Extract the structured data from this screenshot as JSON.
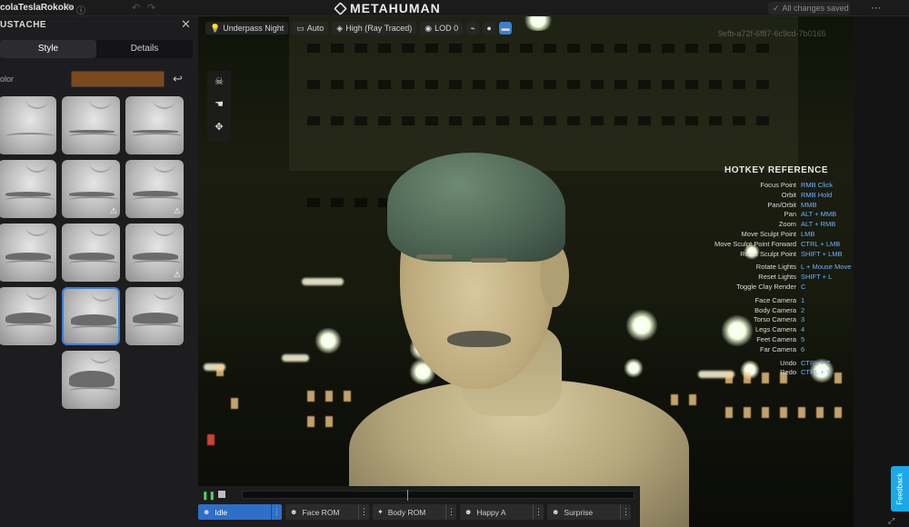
{
  "topbar": {
    "project_name": "colaTeslaRokoko",
    "logo_text": "METAHUMAN",
    "saved_status": "All changes saved"
  },
  "panel": {
    "title": "USTACHE",
    "tabs": [
      {
        "label": "Style",
        "active": true
      },
      {
        "label": "Details",
        "active": false
      }
    ],
    "color_label": "olor",
    "color_value": "#7a4a1c",
    "thumbnails": [
      {
        "style": "none",
        "warning": false
      },
      {
        "style": "faint",
        "warning": false
      },
      {
        "style": "faint",
        "warning": false
      },
      {
        "style": "thin",
        "warning": false
      },
      {
        "style": "thin",
        "warning": true
      },
      {
        "style": "pencil",
        "warning": true
      },
      {
        "style": "medium",
        "warning": false
      },
      {
        "style": "medium",
        "warning": false
      },
      {
        "style": "medium",
        "warning": true
      },
      {
        "style": "full",
        "warning": false
      },
      {
        "style": "full",
        "warning": false,
        "selected": true
      },
      {
        "style": "full",
        "warning": false
      },
      {
        "style": "walrus",
        "warning": false
      }
    ]
  },
  "viewport": {
    "toolbar": {
      "lighting": "Underpass Night",
      "camera": "Auto",
      "quality": "High (Ray Traced)",
      "lod": "LOD 0"
    },
    "asset_id": "9efb-a72f-6f87-6c9cd-7b0165",
    "hotkeys": {
      "title": "HOTKEY REFERENCE",
      "groups": [
        [
          {
            "action": "Focus Point",
            "key": "RMB Click"
          },
          {
            "action": "Orbit",
            "key": "RMB Hold"
          },
          {
            "action": "Pan/Orbit",
            "key": "MMB"
          },
          {
            "action": "Pan",
            "key": "ALT + MMB"
          },
          {
            "action": "Zoom",
            "key": "ALT + RMB"
          },
          {
            "action": "Move Sculpt Point",
            "key": "LMB"
          },
          {
            "action": "Move Sculpt Point Forward",
            "key": "CTRL + LMB"
          },
          {
            "action": "Reset Sculpt Point",
            "key": "SHIFT + LMB"
          }
        ],
        [
          {
            "action": "Rotate Lights",
            "key": "L + Mouse Move"
          },
          {
            "action": "Reset Lights",
            "key": "SHIFT + L"
          },
          {
            "action": "Toggle Clay Render",
            "key": "C"
          }
        ],
        [
          {
            "action": "Face Camera",
            "key": "1"
          },
          {
            "action": "Body Camera",
            "key": "2"
          },
          {
            "action": "Torso Camera",
            "key": "3"
          },
          {
            "action": "Legs Camera",
            "key": "4"
          },
          {
            "action": "Feet Camera",
            "key": "5"
          },
          {
            "action": "Far Camera",
            "key": "6"
          }
        ],
        [
          {
            "action": "Undo",
            "key": "CTRL + Z"
          },
          {
            "action": "Redo",
            "key": "CTRL + Y"
          }
        ]
      ]
    }
  },
  "animbar": {
    "playhead_fraction": 0.42,
    "animations": [
      {
        "label": "Idle",
        "icon": "face-icon",
        "active": true
      },
      {
        "label": "Face ROM",
        "icon": "face-icon",
        "active": false
      },
      {
        "label": "Body ROM",
        "icon": "body-icon",
        "active": false
      },
      {
        "label": "Happy A",
        "icon": "face-icon",
        "active": false
      },
      {
        "label": "Surprise",
        "icon": "face-icon",
        "active": false
      }
    ]
  },
  "feedback_label": "Feedback"
}
